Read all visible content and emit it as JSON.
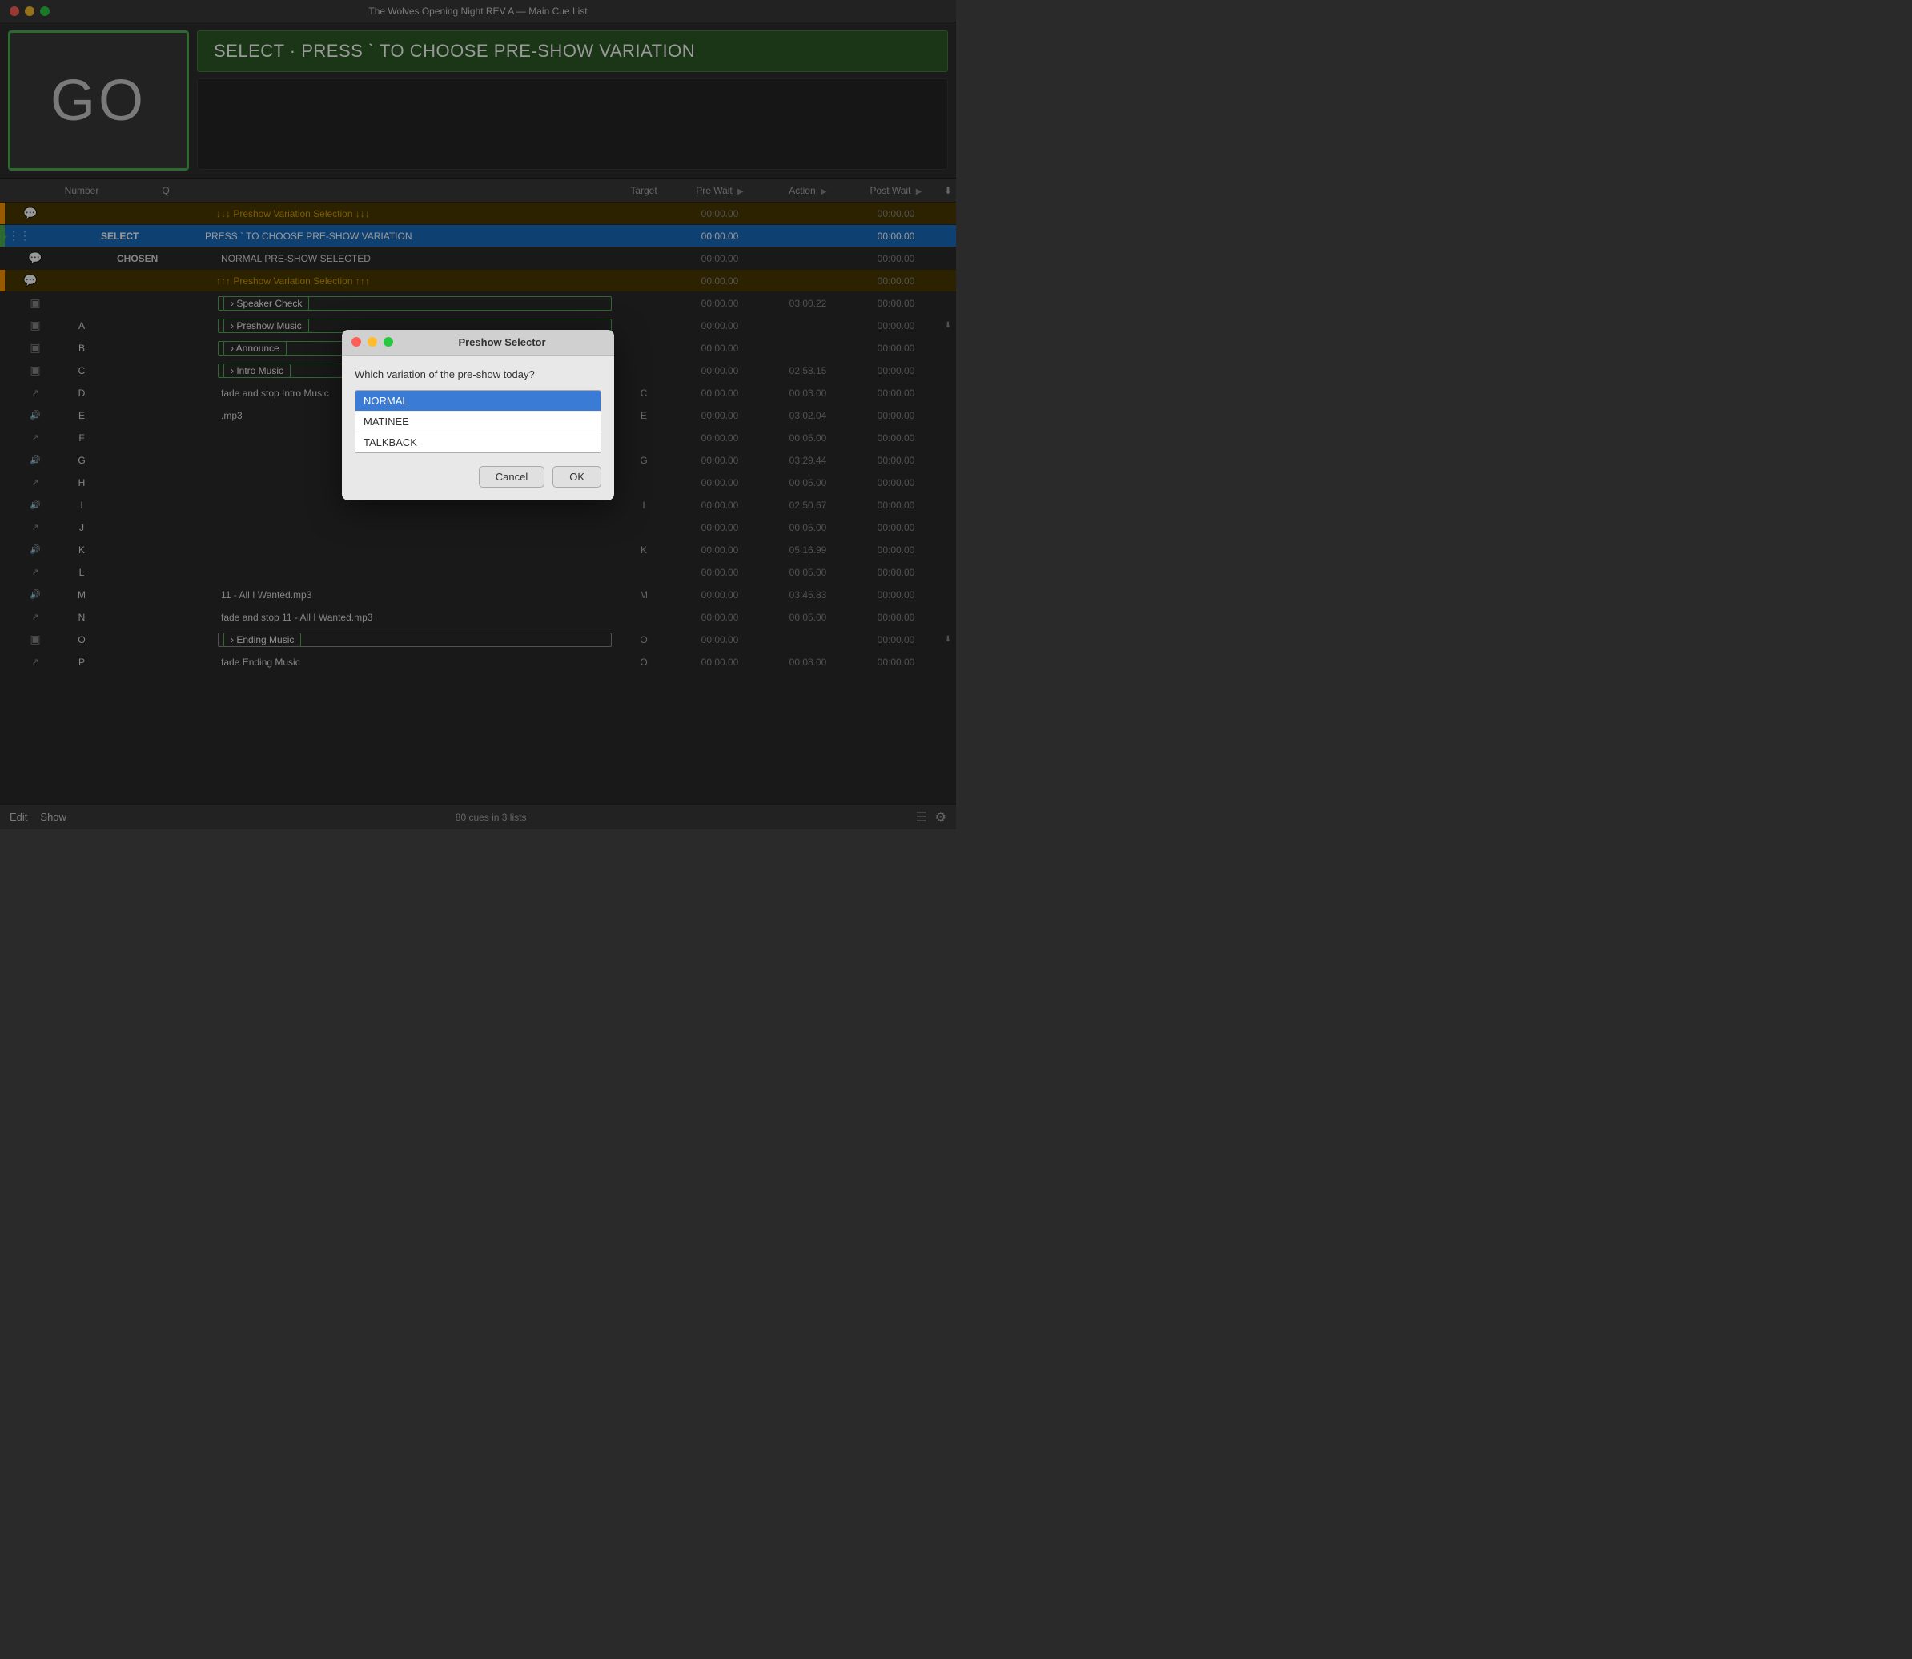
{
  "titlebar": {
    "title": "The Wolves Opening Night REV A — Main Cue List"
  },
  "go_button": {
    "label": "GO"
  },
  "status_banner": {
    "text": "SELECT · PRESS ` TO CHOOSE PRE-SHOW VARIATION"
  },
  "cue_list": {
    "headers": {
      "number": "Number",
      "q": "Q",
      "target": "Target",
      "pre_wait": "Pre Wait",
      "action": "Action",
      "post_wait": "Post Wait"
    },
    "rows": [
      {
        "id": 1,
        "icon": "💬",
        "number": "",
        "q": "",
        "name": "↓↓↓ Preshow Variation Selection ↓↓↓",
        "target": "",
        "pre_wait": "00:00.00",
        "action": "",
        "post_wait": "00:00.00",
        "type": "section",
        "indicator": "orange"
      },
      {
        "id": 2,
        "icon": "⋮⋮",
        "number": "",
        "q": "SELECT",
        "name": "PRESS ` TO CHOOSE PRE-SHOW VARIATION",
        "target": "",
        "pre_wait": "00:00.00",
        "action": "",
        "post_wait": "00:00.00",
        "type": "active",
        "indicator": "green",
        "hasPlay": true
      },
      {
        "id": 3,
        "icon": "💬",
        "number": "",
        "q": "CHOSEN",
        "name": "NORMAL PRE-SHOW  SELECTED",
        "target": "",
        "pre_wait": "00:00.00",
        "action": "",
        "post_wait": "00:00.00",
        "type": "normal"
      },
      {
        "id": 4,
        "icon": "💬",
        "number": "",
        "q": "",
        "name": "↑↑↑ Preshow Variation Selection ↑↑↑",
        "target": "",
        "pre_wait": "00:00.00",
        "action": "",
        "post_wait": "00:00.00",
        "type": "section",
        "indicator": "orange"
      },
      {
        "id": 5,
        "icon": "📋",
        "number": "",
        "q": "",
        "name": "› Speaker Check",
        "target": "",
        "pre_wait": "00:00.00",
        "action": "03:00.22",
        "post_wait": "00:00.00",
        "type": "group"
      },
      {
        "id": 6,
        "icon": "📋",
        "number": "A",
        "q": "",
        "name": "› Preshow Music",
        "target": "",
        "pre_wait": "00:00.00",
        "action": "",
        "post_wait": "00:00.00",
        "type": "group",
        "hasChevron": true
      },
      {
        "id": 7,
        "icon": "📋",
        "number": "B",
        "q": "",
        "name": "› Announce",
        "target": "",
        "pre_wait": "00:00.00",
        "action": "",
        "post_wait": "00:00.00",
        "type": "group"
      },
      {
        "id": 8,
        "icon": "📋",
        "number": "C",
        "q": "",
        "name": "› Intro Music",
        "target": "",
        "pre_wait": "00:00.00",
        "action": "02:58.15",
        "post_wait": "00:00.00",
        "type": "group"
      },
      {
        "id": 9,
        "icon": "↗",
        "number": "D",
        "q": "",
        "name": "fade and stop Intro Music",
        "target": "C",
        "pre_wait": "00:00.00",
        "action": "00:03.00",
        "post_wait": "00:00.00",
        "type": "normal"
      },
      {
        "id": 10,
        "icon": "🔊",
        "number": "E",
        "q": "",
        "name": ".mp3",
        "target": "E",
        "pre_wait": "00:00.00",
        "action": "03:02.04",
        "post_wait": "00:00.00",
        "type": "normal"
      },
      {
        "id": 11,
        "icon": "↗",
        "number": "F",
        "q": "",
        "name": "",
        "target": "",
        "pre_wait": "00:00.00",
        "action": "00:05.00",
        "post_wait": "00:00.00",
        "type": "normal"
      },
      {
        "id": 12,
        "icon": "🔊",
        "number": "G",
        "q": "",
        "name": "",
        "target": "G",
        "pre_wait": "00:00.00",
        "action": "03:29.44",
        "post_wait": "00:00.00",
        "type": "normal"
      },
      {
        "id": 13,
        "icon": "↗",
        "number": "H",
        "q": "",
        "name": "",
        "target": "",
        "pre_wait": "00:00.00",
        "action": "00:05.00",
        "post_wait": "00:00.00",
        "type": "normal"
      },
      {
        "id": 14,
        "icon": "🔊",
        "number": "I",
        "q": "",
        "name": "",
        "target": "I",
        "pre_wait": "00:00.00",
        "action": "02:50.67",
        "post_wait": "00:00.00",
        "type": "normal"
      },
      {
        "id": 15,
        "icon": "↗",
        "number": "J",
        "q": "",
        "name": "",
        "target": "",
        "pre_wait": "00:00.00",
        "action": "00:05.00",
        "post_wait": "00:00.00",
        "type": "normal"
      },
      {
        "id": 16,
        "icon": "🔊",
        "number": "K",
        "q": "",
        "name": "",
        "target": "K",
        "pre_wait": "00:00.00",
        "action": "05:16.99",
        "post_wait": "00:00.00",
        "type": "normal"
      },
      {
        "id": 17,
        "icon": "↗",
        "number": "L",
        "q": "",
        "name": "",
        "target": "",
        "pre_wait": "00:00.00",
        "action": "00:05.00",
        "post_wait": "00:00.00",
        "type": "normal"
      },
      {
        "id": 18,
        "icon": "🔊",
        "number": "M",
        "q": "",
        "name": "11 - All I Wanted.mp3",
        "target": "M",
        "pre_wait": "00:00.00",
        "action": "03:45.83",
        "post_wait": "00:00.00",
        "type": "normal"
      },
      {
        "id": 19,
        "icon": "↗",
        "number": "N",
        "q": "",
        "name": "fade and stop 11 - All I Wanted.mp3",
        "target": "",
        "pre_wait": "00:00.00",
        "action": "00:05.00",
        "post_wait": "00:00.00",
        "type": "normal"
      },
      {
        "id": 20,
        "icon": "📋",
        "number": "O",
        "q": "",
        "name": "› Ending Music",
        "target": "O",
        "pre_wait": "00:00.00",
        "action": "",
        "post_wait": "00:00.00",
        "type": "group-dark",
        "hasChevron": true
      },
      {
        "id": 21,
        "icon": "↗",
        "number": "P",
        "q": "",
        "name": "fade Ending Music",
        "target": "O",
        "pre_wait": "00:00.00",
        "action": "00:08.00",
        "post_wait": "00:00.00",
        "type": "normal"
      }
    ]
  },
  "modal": {
    "title": "Preshow Selector",
    "question": "Which variation of the pre-show today?",
    "options": [
      "NORMAL",
      "MATINEE",
      "TALKBACK"
    ],
    "selected": "NORMAL",
    "cancel_label": "Cancel",
    "ok_label": "OK"
  },
  "bottom_bar": {
    "edit_label": "Edit",
    "show_label": "Show",
    "cue_count": "80 cues in 3 lists"
  }
}
